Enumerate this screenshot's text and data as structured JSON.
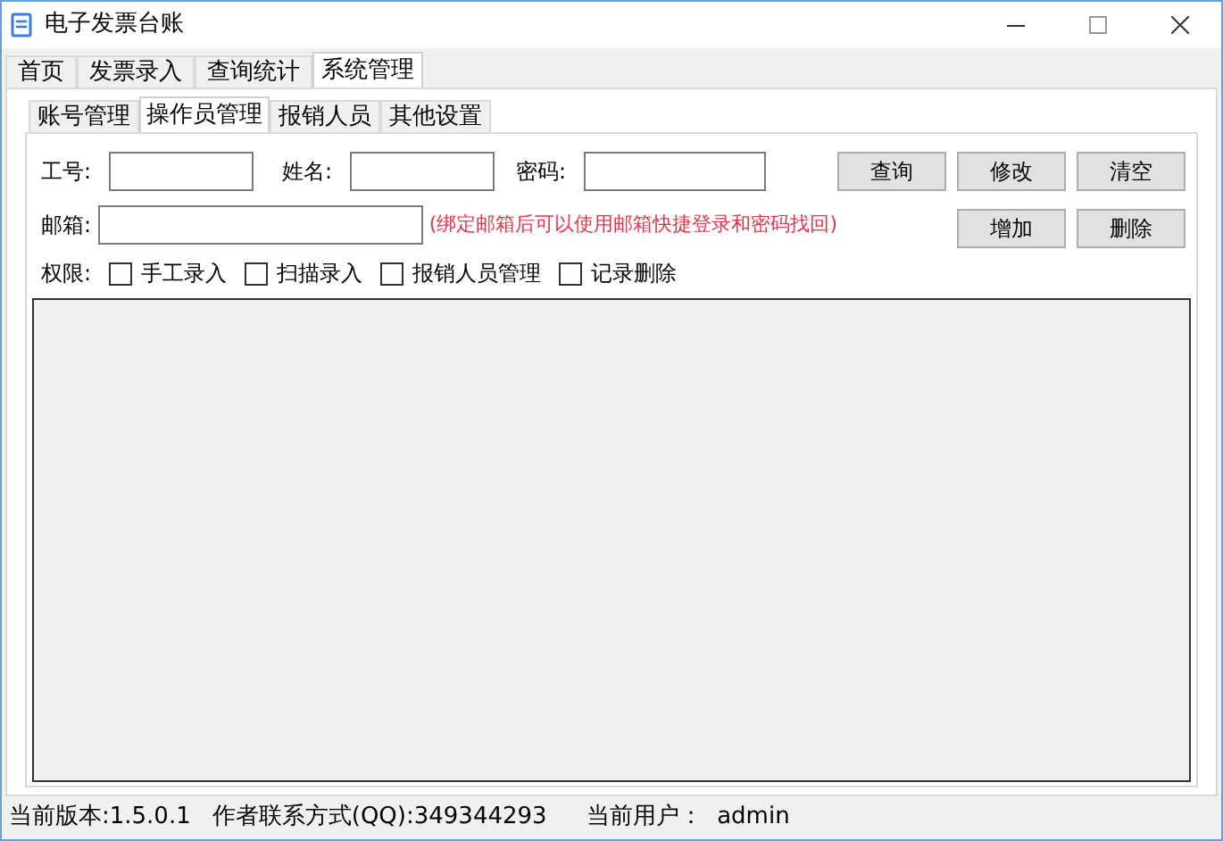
{
  "window": {
    "title": "电子发票台账"
  },
  "tabs": [
    {
      "label": "首页",
      "selected": false
    },
    {
      "label": "发票录入",
      "selected": false
    },
    {
      "label": "查询统计",
      "selected": false
    },
    {
      "label": "系统管理",
      "selected": true
    }
  ],
  "subtabs": [
    {
      "label": "账号管理",
      "selected": false
    },
    {
      "label": "操作员管理",
      "selected": true
    },
    {
      "label": "报销人员",
      "selected": false
    },
    {
      "label": "其他设置",
      "selected": false
    }
  ],
  "fields": [
    {
      "label": "工号:"
    },
    {
      "label": "姓名:"
    },
    {
      "label": "密码:"
    }
  ],
  "email": {
    "label": "邮箱:",
    "hint": "(绑定邮箱后可以使用邮箱快捷登录和密码找回)"
  },
  "buttons": [
    "查询",
    "修改",
    "清空",
    "增加",
    "删除"
  ],
  "permissions": {
    "label": "权限:",
    "items": [
      {
        "label": "手工录入",
        "checked": false
      },
      {
        "label": "扫描录入",
        "checked": false
      },
      {
        "label": "报销人员管理",
        "checked": false
      },
      {
        "label": "记录删除",
        "checked": false
      }
    ]
  },
  "status_bar": [
    "当前版本:1.5.0.1",
    "作者联系方式(QQ):349344293",
    "当前用户：  admin"
  ]
}
